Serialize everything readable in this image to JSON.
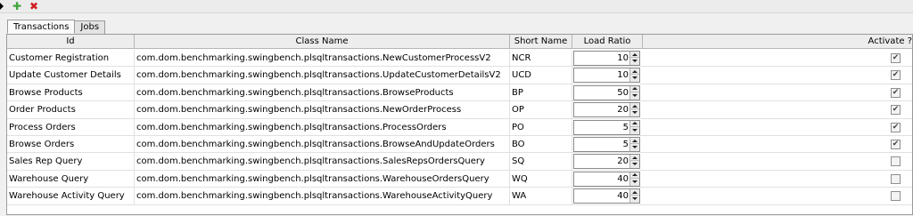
{
  "toolbar": {
    "add_icon": "plus-icon",
    "delete_icon": "close-icon",
    "add_glyph": "✚",
    "delete_glyph": "✖"
  },
  "tabs": [
    {
      "label": "Transactions",
      "active": true
    },
    {
      "label": "Jobs",
      "active": false
    }
  ],
  "table": {
    "columns": [
      "Id",
      "Class Name",
      "Short Name",
      "Load Ratio",
      "Activate ?"
    ],
    "rows": [
      {
        "id": "Customer Registration",
        "class_name": "com.dom.benchmarking.swingbench.plsqltransactions.NewCustomerProcessV2",
        "short_name": "NCR",
        "load_ratio": "10",
        "active": true
      },
      {
        "id": "Update Customer Details",
        "class_name": "com.dom.benchmarking.swingbench.plsqltransactions.UpdateCustomerDetailsV2",
        "short_name": "UCD",
        "load_ratio": "10",
        "active": true
      },
      {
        "id": "Browse Products",
        "class_name": "com.dom.benchmarking.swingbench.plsqltransactions.BrowseProducts",
        "short_name": "BP",
        "load_ratio": "50",
        "active": true
      },
      {
        "id": "Order Products",
        "class_name": "com.dom.benchmarking.swingbench.plsqltransactions.NewOrderProcess",
        "short_name": "OP",
        "load_ratio": "20",
        "active": true
      },
      {
        "id": "Process Orders",
        "class_name": "com.dom.benchmarking.swingbench.plsqltransactions.ProcessOrders",
        "short_name": "PO",
        "load_ratio": "5",
        "active": true
      },
      {
        "id": "Browse Orders",
        "class_name": "com.dom.benchmarking.swingbench.plsqltransactions.BrowseAndUpdateOrders",
        "short_name": "BO",
        "load_ratio": "5",
        "active": true
      },
      {
        "id": "Sales Rep Query",
        "class_name": "com.dom.benchmarking.swingbench.plsqltransactions.SalesRepsOrdersQuery",
        "short_name": "SQ",
        "load_ratio": "20",
        "active": false
      },
      {
        "id": "Warehouse Query",
        "class_name": "com.dom.benchmarking.swingbench.plsqltransactions.WarehouseOrdersQuery",
        "short_name": "WQ",
        "load_ratio": "40",
        "active": false
      },
      {
        "id": "Warehouse Activity Query",
        "class_name": "com.dom.benchmarking.swingbench.plsqltransactions.WarehouseActivityQuery",
        "short_name": "WA",
        "load_ratio": "40",
        "active": false
      }
    ]
  }
}
